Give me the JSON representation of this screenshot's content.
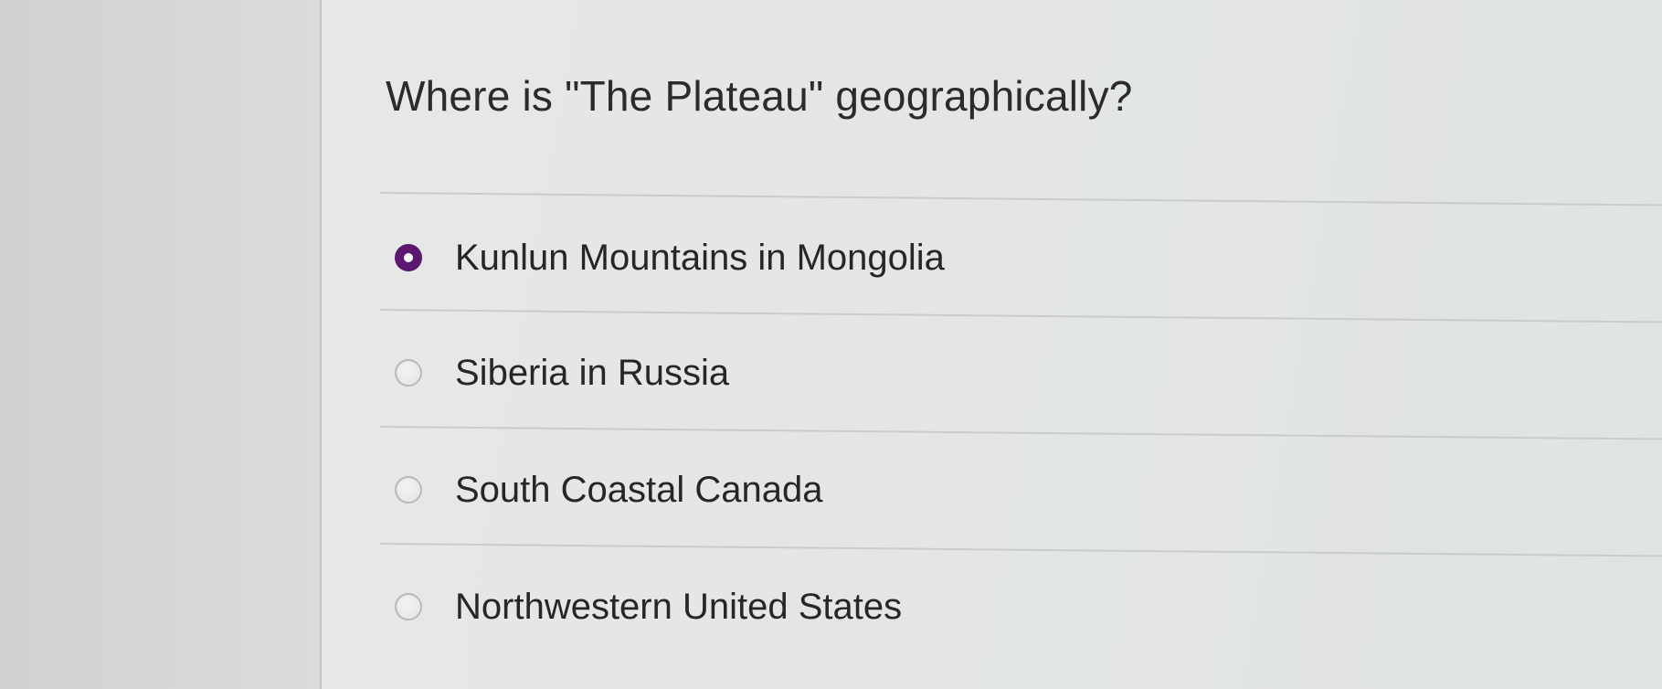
{
  "question": {
    "text": "Where is \"The Plateau\" geographically?"
  },
  "options": [
    {
      "label": "Kunlun Mountains in Mongolia",
      "selected": true
    },
    {
      "label": "Siberia in Russia",
      "selected": false
    },
    {
      "label": "South Coastal Canada",
      "selected": false
    },
    {
      "label": "Northwestern United States",
      "selected": false
    }
  ],
  "colors": {
    "selected_radio": "#5b1870",
    "text": "#262626"
  }
}
